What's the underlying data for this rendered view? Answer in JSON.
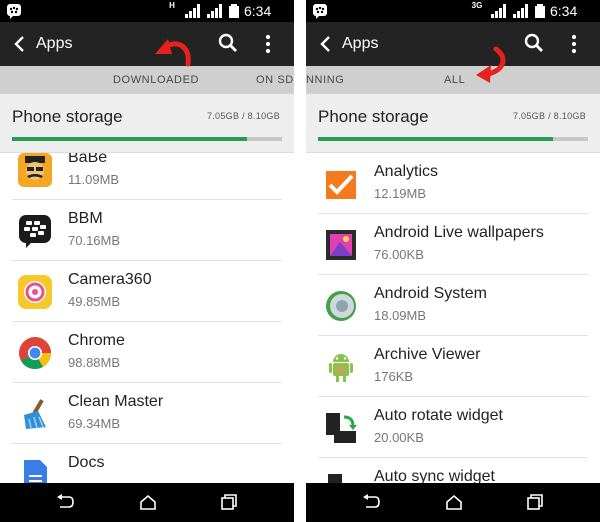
{
  "left": {
    "status": {
      "net": "H",
      "time": "6:34 PM"
    },
    "title": "Apps",
    "tabs": [
      "DOWNLOADED",
      "ON SD C"
    ],
    "storage": {
      "label": "Phone storage",
      "size": "7.05GB / 8.10GB",
      "used_fraction": 0.87
    },
    "apps": [
      {
        "name": "BaBe",
        "size": "11.09MB",
        "icon": "babe-icon"
      },
      {
        "name": "BBM",
        "size": "70.16MB",
        "icon": "bbm-icon"
      },
      {
        "name": "Camera360",
        "size": "49.85MB",
        "icon": "camera360-icon"
      },
      {
        "name": "Chrome",
        "size": "98.88MB",
        "icon": "chrome-icon"
      },
      {
        "name": "Clean Master",
        "size": "69.34MB",
        "icon": "clean-master-icon"
      },
      {
        "name": "Docs",
        "size": "",
        "icon": "docs-icon"
      }
    ]
  },
  "right": {
    "status": {
      "net": "3G",
      "time": "6:34 PM"
    },
    "title": "Apps",
    "tabs": [
      "NNING",
      "ALL"
    ],
    "storage": {
      "label": "Phone storage",
      "size": "7.05GB / 8.10GB",
      "used_fraction": 0.87
    },
    "apps": [
      {
        "name": "Analytics",
        "size": "12.19MB",
        "icon": "analytics-icon"
      },
      {
        "name": "Android Live wallpapers",
        "size": "76.00KB",
        "icon": "live-wallpapers-icon"
      },
      {
        "name": "Android System",
        "size": "18.09MB",
        "icon": "android-system-icon"
      },
      {
        "name": "Archive Viewer",
        "size": "176KB",
        "icon": "archive-viewer-icon"
      },
      {
        "name": "Auto rotate widget",
        "size": "20.00KB",
        "icon": "auto-rotate-icon"
      },
      {
        "name": "Auto sync widget",
        "size": "",
        "icon": "auto-sync-icon"
      }
    ]
  },
  "colors": {
    "progress": "#2a9b52",
    "annotation_arrow": "#e8211c",
    "appbar": "#232323",
    "tabbar": "#cfcfcf"
  }
}
